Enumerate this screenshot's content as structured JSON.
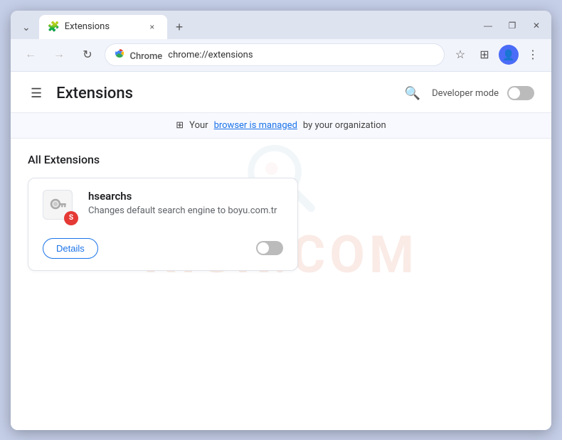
{
  "browser": {
    "tab": {
      "favicon": "🧩",
      "title": "Extensions",
      "close_label": "×"
    },
    "new_tab_label": "+",
    "window_controls": {
      "minimize": "—",
      "maximize": "❐",
      "close": "✕"
    },
    "nav": {
      "back_label": "←",
      "forward_label": "→",
      "reload_label": "↻",
      "chrome_brand": "Chrome",
      "address": "chrome://extensions",
      "star_label": "☆",
      "extensions_label": "⊞",
      "profile_label": "👤",
      "menu_label": "⋮"
    }
  },
  "extensions_page": {
    "hamburger_label": "☰",
    "title": "Extensions",
    "search_label": "🔍",
    "developer_mode_label": "Developer mode",
    "managed_notice_prefix": "Your ",
    "managed_notice_link": "browser is managed",
    "managed_notice_suffix": " by your organization",
    "managed_icon": "⊞",
    "section_title": "All Extensions",
    "extension": {
      "name": "hsearchs",
      "description": "Changes default search engine to boyu.com.tr",
      "icon_emoji": "🔑",
      "details_label": "Details"
    },
    "watermark_text": "RISK.COM"
  }
}
